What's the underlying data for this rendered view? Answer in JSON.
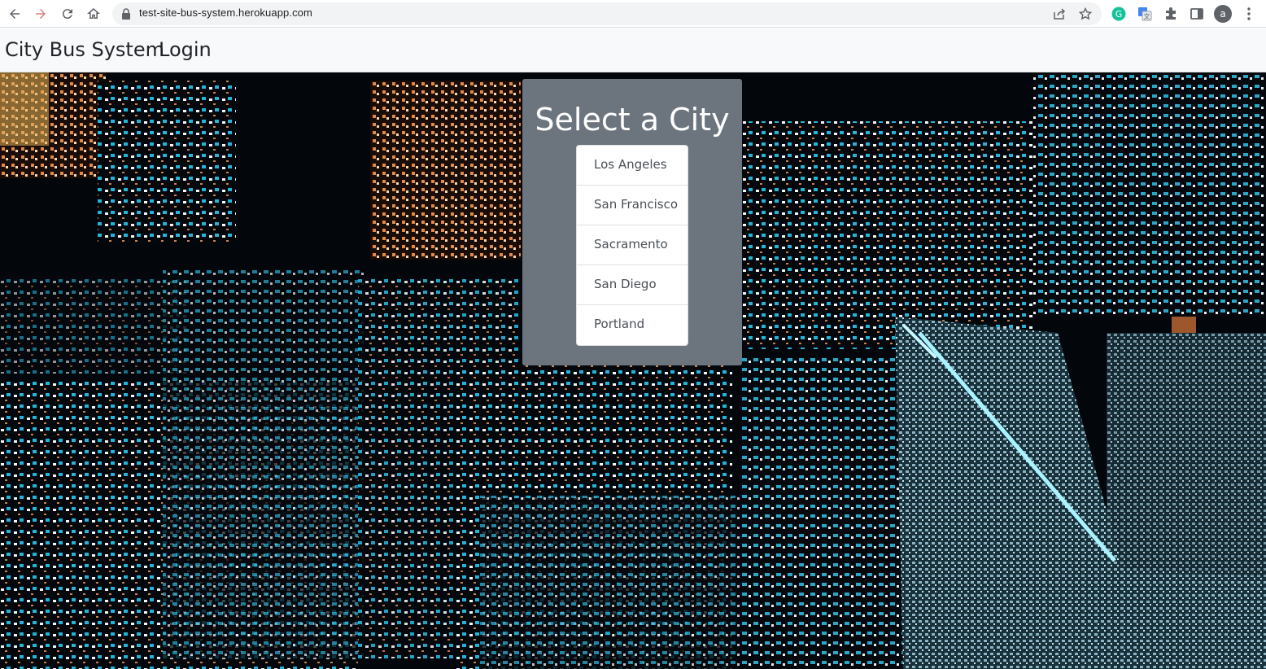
{
  "browser": {
    "url": "test-site-bus-system.herokuapp.com",
    "profile_initial": "a"
  },
  "navbar": {
    "brand": "City Bus System",
    "login": "Login"
  },
  "card": {
    "title": "Select a City",
    "cities": [
      "Los Angeles",
      "San Francisco",
      "Sacramento",
      "San Diego",
      "Portland"
    ]
  },
  "colors": {
    "card_bg": "#6c757d",
    "navbar_bg": "#f8f9fa",
    "accent": "#1a73e8"
  }
}
